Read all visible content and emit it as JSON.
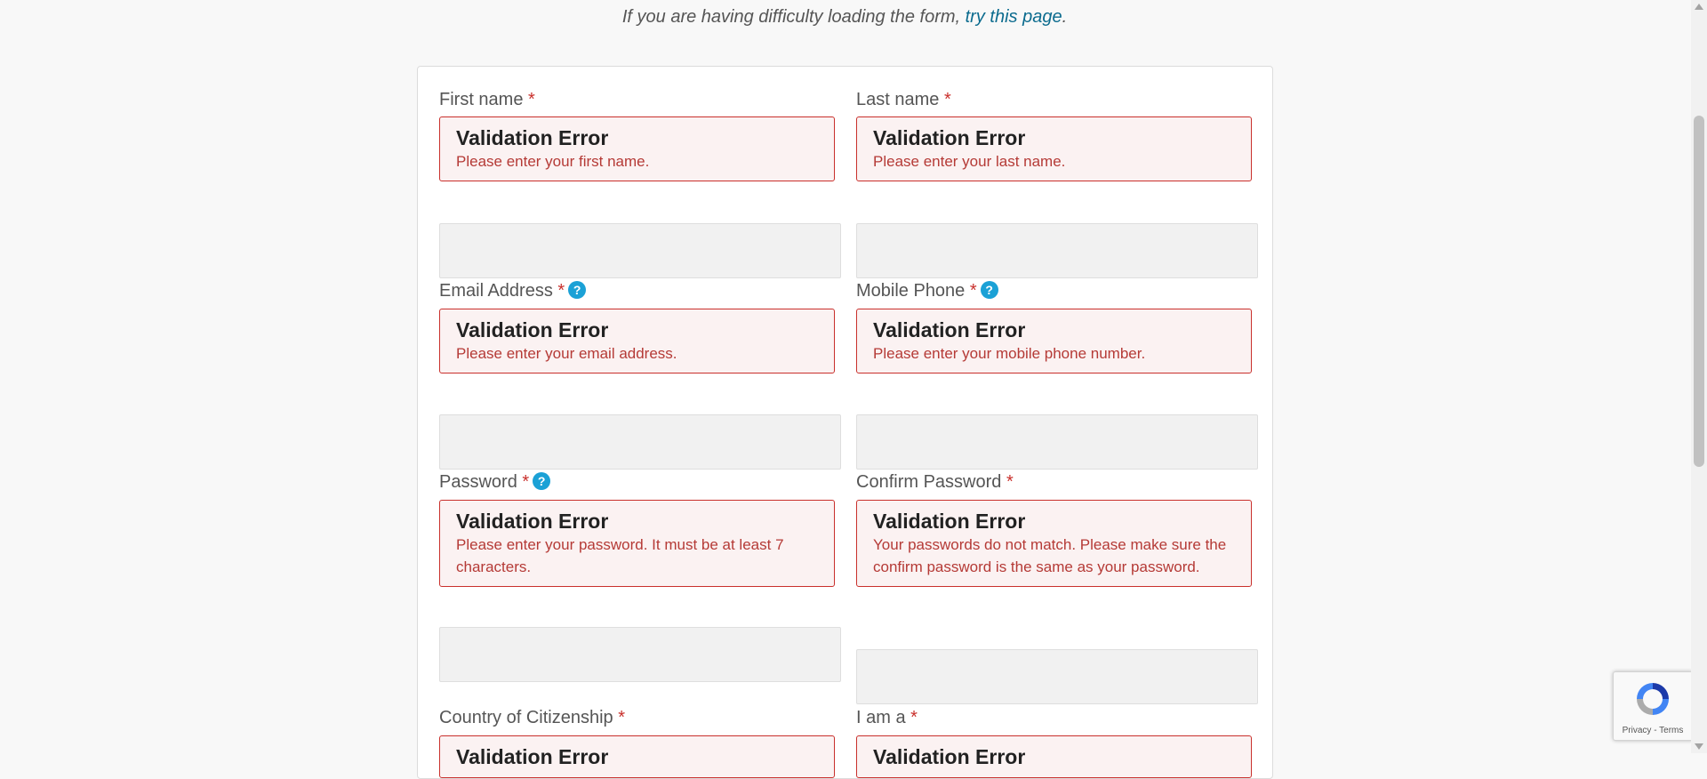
{
  "notice": {
    "text_before": "If you are having difficulty loading the form, ",
    "link_text": "try this page",
    "text_after": "."
  },
  "error_title": "Validation Error",
  "required_marker": "*",
  "help_icon_glyph": "?",
  "fields": {
    "first_name": {
      "label": "First name",
      "error": "Please enter your first name.",
      "value": ""
    },
    "last_name": {
      "label": "Last name",
      "error": "Please enter your last name.",
      "value": ""
    },
    "email": {
      "label": "Email Address",
      "error": "Please enter your email address.",
      "value": ""
    },
    "mobile": {
      "label": "Mobile Phone",
      "error": "Please enter your mobile phone number.",
      "value": ""
    },
    "password": {
      "label": "Password",
      "error": "Please enter your password. It must be at least 7 characters.",
      "value": ""
    },
    "confirm_password": {
      "label": "Confirm Password",
      "error": "Your passwords do not match. Please make sure the confirm password is the same as your password.",
      "value": ""
    },
    "country": {
      "label": "Country of Citizenship",
      "error": "Validation Error"
    },
    "i_am_a": {
      "label": "I am a",
      "error": "Validation Error"
    }
  },
  "recaptcha": {
    "privacy": "Privacy",
    "separator": " - ",
    "terms": "Terms"
  },
  "colors": {
    "required": "#c9302c",
    "error_border": "#c9302c",
    "error_background": "#fbf2f2",
    "link": "#0b6b8e",
    "help_icon": "#1ba1d6"
  },
  "icons": {
    "help": "question-circle-icon",
    "recaptcha": "recaptcha-logo-icon"
  }
}
